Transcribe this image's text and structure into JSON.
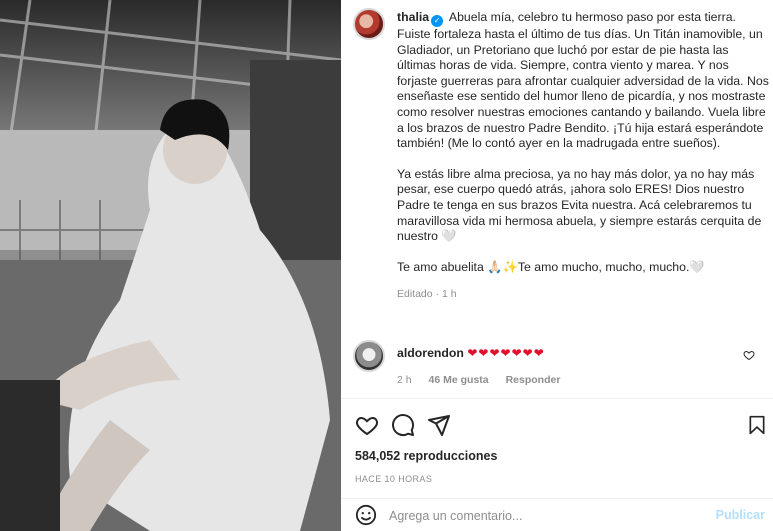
{
  "post": {
    "username": "thalia",
    "caption_paragraphs": [
      "Abuela mía, celebro tu hermoso paso por esta tierra. Fuiste fortaleza hasta el último de tus días. Un Titán inamovible, un Gladiador, un Pretoriano que luchó por estar de pie hasta las últimas horas de vida. Siempre, contra viento y marea. Y nos forjaste guerreras para afrontar cualquier adversidad de la vida. Nos enseñaste ese sentido del humor lleno de picardía, y nos mostraste como resolver nuestras emociones cantando y bailando. Vuela libre a los brazos de nuestro Padre Bendito. ¡Tú hija estará esperándote también! (Me lo contó ayer en la madrugada entre sueños).",
      "Ya estás libre alma preciosa, ya no hay más dolor, ya no hay más pesar, ese cuerpo quedó atrás, ¡ahora solo ERES! Dios nuestro Padre te tenga en sus brazos Evita nuestra. Acá celebraremos tu maravillosa vida mi hermosa abuela, y siempre estarás cerquita de nuestro 🤍",
      "Te amo abuelita 🙏🏻✨Te amo mucho, mucho, mucho.🤍"
    ],
    "edited_label": "Editado · 1 h"
  },
  "reply": {
    "username": "aldorendon",
    "hearts": "❤❤❤❤❤❤❤",
    "time": "2 h",
    "likes": "46 Me gusta",
    "reply_label": "Responder"
  },
  "actions": {
    "views": "584,052 reproducciones",
    "timestamp": "HACE 10 HORAS"
  },
  "comment_box": {
    "placeholder": "Agrega un comentario...",
    "post_label": "Publicar"
  },
  "colors": {
    "verified": "#0095f6",
    "heart": "#e0102d",
    "post_button": "#b2dffc"
  },
  "icons": [
    "verified-icon",
    "heart-icon",
    "comment-icon",
    "share-icon",
    "bookmark-icon",
    "emoji-icon",
    "like-small-icon"
  ]
}
